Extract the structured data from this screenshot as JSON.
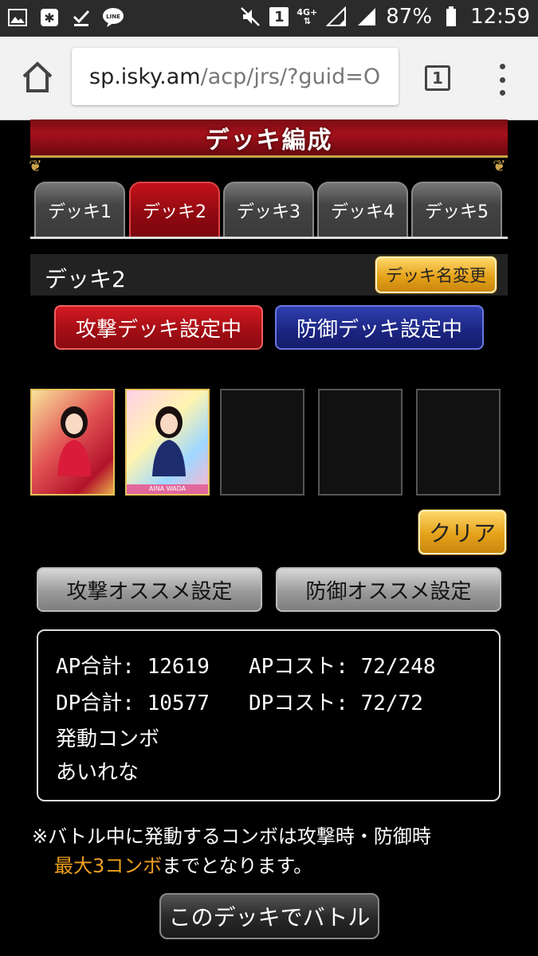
{
  "status_bar": {
    "battery": "87%",
    "time": "12:59",
    "sim_badge": "1",
    "network": "4G+",
    "icons": [
      "image-icon",
      "app-notification-icon",
      "download-done-icon",
      "line-icon",
      "mute-icon",
      "signal-icon",
      "battery-icon"
    ]
  },
  "browser": {
    "url_host": "sp.isky.am",
    "url_path": "/acp/jrs/?guid=O",
    "tab_count": "1"
  },
  "page": {
    "title": "デッキ編成",
    "tabs": [
      {
        "label": "デッキ1",
        "active": false
      },
      {
        "label": "デッキ2",
        "active": true
      },
      {
        "label": "デッキ3",
        "active": false
      },
      {
        "label": "デッキ4",
        "active": false
      },
      {
        "label": "デッキ5",
        "active": false
      }
    ],
    "deck_name": "デッキ2",
    "rename_label": "デッキ名変更",
    "attack_mode_label": "攻撃デッキ設定中",
    "defense_mode_label": "防御デッキ設定中",
    "cards": [
      {
        "slot": 1,
        "filled": true,
        "caption": ""
      },
      {
        "slot": 2,
        "filled": true,
        "caption": "AINA WADA"
      },
      {
        "slot": 3,
        "filled": false
      },
      {
        "slot": 4,
        "filled": false
      },
      {
        "slot": 5,
        "filled": false
      }
    ],
    "clear_label": "クリア",
    "attack_recommend_label": "攻撃オススメ設定",
    "defense_recommend_label": "防御オススメ設定",
    "stats": {
      "ap_total": "AP合計: 12619",
      "ap_cost": "APコスト: 72/248",
      "dp_total": "DP合計: 10577",
      "dp_cost": "DPコスト: 72/72",
      "combo_label": "発動コンボ",
      "combo_value": "あいれな"
    },
    "note_line1": "※バトル中に発動するコンボは攻撃時・防御時",
    "note_highlight": "最大3コンボ",
    "note_line2_rest": "までとなります。",
    "battle_label": "このデッキでバトル"
  },
  "colors": {
    "tab_active": "#a10d14",
    "attack_red": "#b0121a",
    "defense_blue": "#1b2580",
    "gold": "#e5a21a",
    "note_highlight": "#f0a020"
  }
}
